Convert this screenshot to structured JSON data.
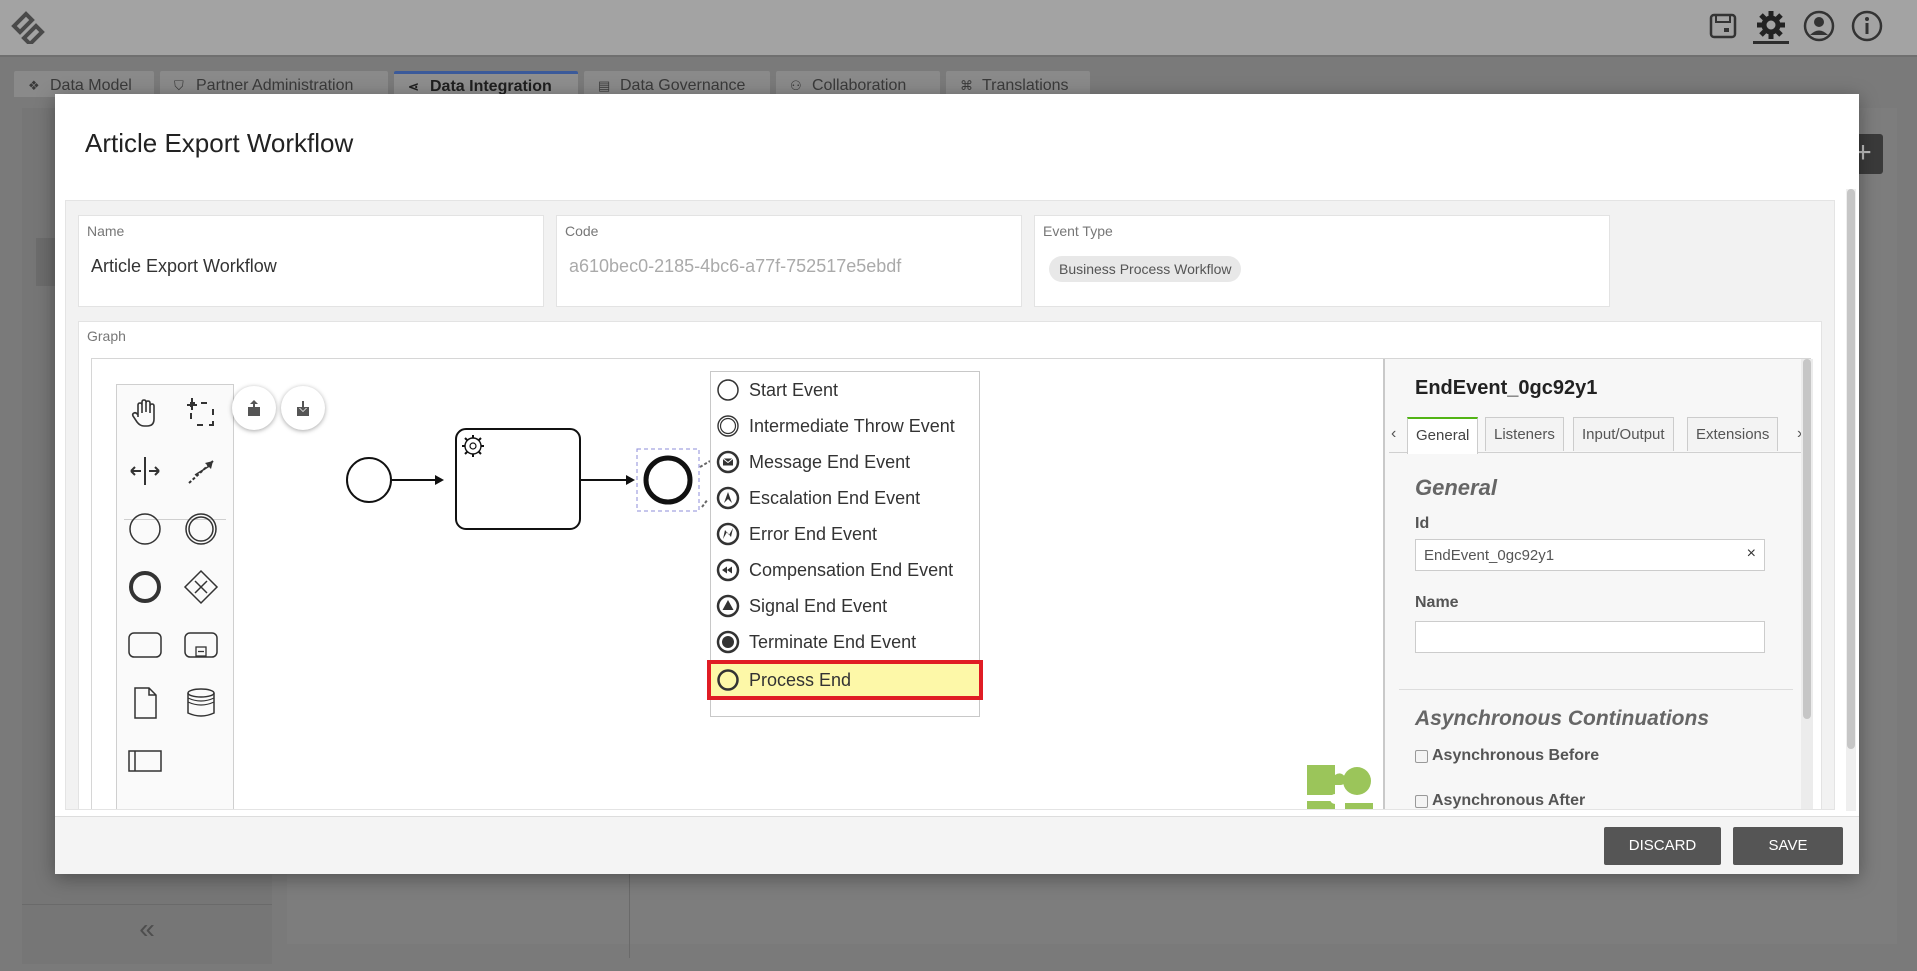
{
  "app": {
    "tabs": [
      {
        "label": "Data Model",
        "icon": "cubes-icon"
      },
      {
        "label": "Partner Administration",
        "icon": "shield-icon"
      },
      {
        "label": "Data Integration",
        "icon": "share-icon"
      },
      {
        "label": "Data Governance",
        "icon": "document-icon"
      },
      {
        "label": "Collaboration",
        "icon": "people-icon"
      },
      {
        "label": "Translations",
        "icon": "translate-icon"
      }
    ],
    "active_tab": "Data Integration",
    "collapse_label": "«"
  },
  "modal": {
    "title": "Article Export Workflow",
    "fields": {
      "name": {
        "label": "Name",
        "value": "Article Export Workflow"
      },
      "code": {
        "label": "Code",
        "value": "a610bec0-2185-4bc6-a77f-752517e5ebdf"
      },
      "event_type": {
        "label": "Event Type",
        "value": "Business Process Workflow"
      }
    },
    "graph_label": "Graph",
    "replace_menu": [
      {
        "label": "Start Event",
        "icon": "start-event-icon"
      },
      {
        "label": "Intermediate Throw Event",
        "icon": "intermediate-throw-event-icon"
      },
      {
        "label": "Message End Event",
        "icon": "message-end-event-icon"
      },
      {
        "label": "Escalation End Event",
        "icon": "escalation-end-event-icon"
      },
      {
        "label": "Error End Event",
        "icon": "error-end-event-icon"
      },
      {
        "label": "Compensation End Event",
        "icon": "compensation-end-event-icon"
      },
      {
        "label": "Signal End Event",
        "icon": "signal-end-event-icon"
      },
      {
        "label": "Terminate End Event",
        "icon": "terminate-end-event-icon"
      },
      {
        "label": "Process End",
        "icon": "process-end-icon",
        "highlighted": true
      }
    ],
    "properties": {
      "title": "EndEvent_0gc92y1",
      "tabs": [
        "General",
        "Listeners",
        "Input/Output",
        "Extensions"
      ],
      "active_tab": "General",
      "section_general": "General",
      "id_label": "Id",
      "id_value": "EndEvent_0gc92y1",
      "name_label": "Name",
      "name_value": "",
      "section_async": "Asynchronous Continuations",
      "async_before": "Asynchronous Before",
      "async_after": "Asynchronous After"
    },
    "footer": {
      "discard": "DISCARD",
      "save": "SAVE"
    }
  },
  "colors": {
    "highlight_fill": "#fdf8a8",
    "highlight_border": "#e01c24",
    "tab_accent": "#52b415",
    "button": "#555555"
  }
}
